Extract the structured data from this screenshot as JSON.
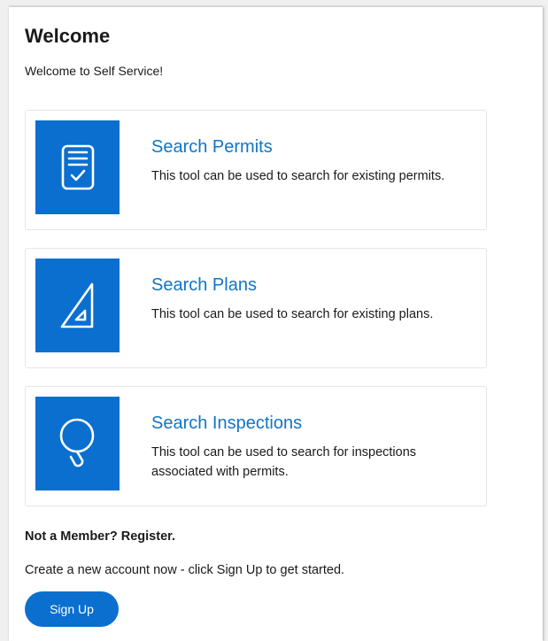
{
  "header": {
    "title": "Welcome",
    "subtitle": "Welcome to Self Service!"
  },
  "cards": [
    {
      "title": "Search Permits",
      "description": "This tool can be used to search for existing permits.",
      "icon": "clipboard-check-icon"
    },
    {
      "title": "Search Plans",
      "description": "This tool can be used to search for existing plans.",
      "icon": "triangle-ruler-icon"
    },
    {
      "title": "Search Inspections",
      "description": "This tool can be used to search for inspections associated with permits.",
      "icon": "magnifier-icon"
    }
  ],
  "member": {
    "heading": "Not a Member? Register.",
    "text": "Create a new account now - click Sign Up to get started.",
    "signup_label": "Sign Up"
  },
  "colors": {
    "accent": "#0a6fcf",
    "link": "#1075c9",
    "text": "#1a1a1a"
  }
}
